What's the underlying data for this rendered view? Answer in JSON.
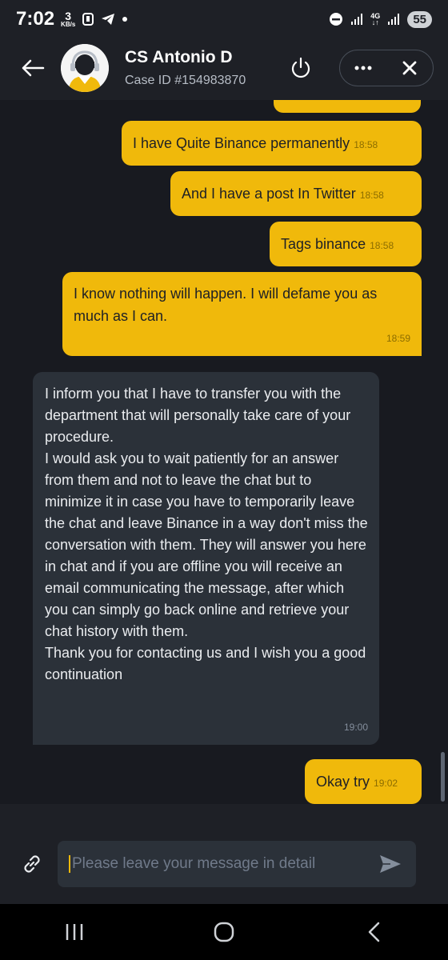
{
  "status_bar": {
    "time": "7:02",
    "data_rate_value": "3",
    "data_rate_unit": "KB/s",
    "network": "4G",
    "battery": "55"
  },
  "header": {
    "agent_name": "CS Antonio D",
    "case_id": "Case ID #154983870"
  },
  "messages": [
    {
      "from": "user",
      "text": "I have Quite Binance permanently",
      "time": "18:58"
    },
    {
      "from": "user",
      "text": "And I have a post In Twitter",
      "time": "18:58"
    },
    {
      "from": "user",
      "text": "Tags binance",
      "time": "18:58"
    },
    {
      "from": "user",
      "text": "I know nothing will happen. I will defame you as much as I can.",
      "time": "18:59"
    },
    {
      "from": "agent",
      "text": "I inform you that I have to transfer you with the department that will personally take care of your procedure.\nI would ask you to wait patiently for an answer from them and not to leave the chat but to minimize it in case you have to temporarily leave the chat and leave Binance in a way don't miss the conversation with them. They will answer you here in chat and if you are offline you will receive an email communicating the message, after which you can simply go back online and retrieve your chat history with them.\nThank you for contacting us and I wish you a good continuation",
      "time": "19:00"
    },
    {
      "from": "user",
      "text": "Okay try",
      "time": "19:02"
    }
  ],
  "input": {
    "placeholder": "Please leave your message in detail",
    "value": ""
  },
  "colors": {
    "accent": "#f0b90b",
    "chat_bg": "#181a20",
    "agent_bubble": "#2b3139"
  }
}
